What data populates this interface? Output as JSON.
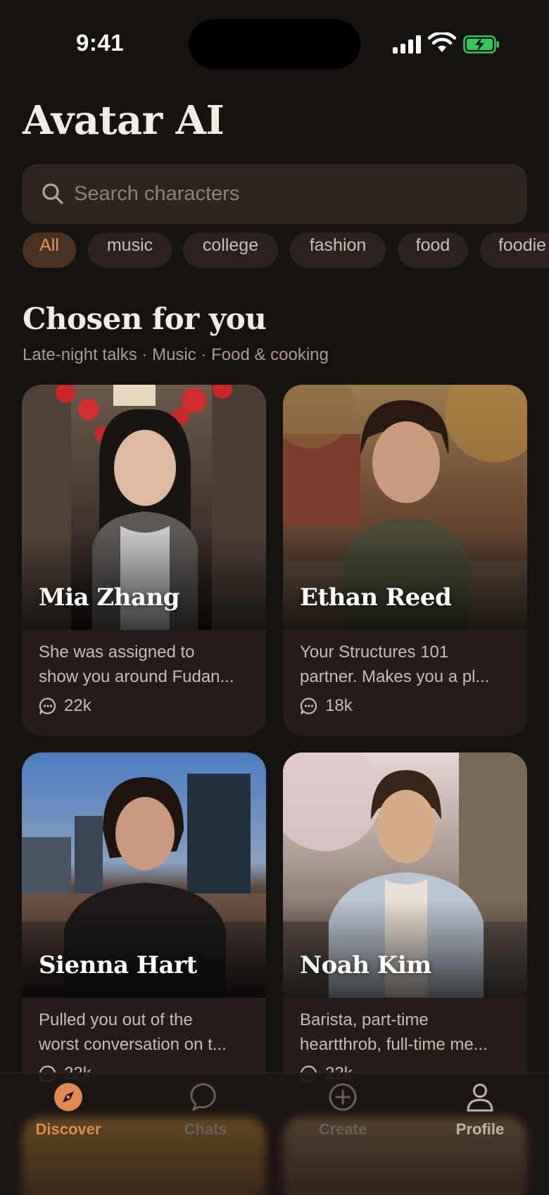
{
  "status_bar": {
    "time": "9:41"
  },
  "app_title": "Avatar AI",
  "search": {
    "placeholder": "Search characters"
  },
  "chips": [
    "All",
    "music",
    "college",
    "fashion",
    "food",
    "foodie"
  ],
  "section": {
    "title": "Chosen for you",
    "subtitle": "Late-night talks · Music · Food & cooking"
  },
  "cards": [
    {
      "name": "Mia Zhang",
      "desc_line1": "She was assigned to",
      "desc_line2": "show you around Fudan...",
      "count": "22k"
    },
    {
      "name": "Ethan Reed",
      "desc_line1": "Your Structures 101",
      "desc_line2": "partner. Makes you a pl...",
      "count": "18k"
    },
    {
      "name": "Sienna Hart",
      "desc_line1": "Pulled you out of the",
      "desc_line2": "worst conversation on t...",
      "count": "22k"
    },
    {
      "name": "Noah Kim",
      "desc_line1": "Barista, part-time",
      "desc_line2": "heartthrob, full-time me...",
      "count": "22k"
    }
  ],
  "tabs": [
    {
      "label": "Discover",
      "icon": "compass-icon"
    },
    {
      "label": "Chats",
      "icon": "chat-bubble-icon"
    },
    {
      "label": "Create",
      "icon": "plus-circle-icon"
    },
    {
      "label": "Profile",
      "icon": "person-icon"
    }
  ],
  "colors": {
    "accent": "#e08a52",
    "background": "#161210",
    "card": "#241d19",
    "battery": "#34c759"
  }
}
